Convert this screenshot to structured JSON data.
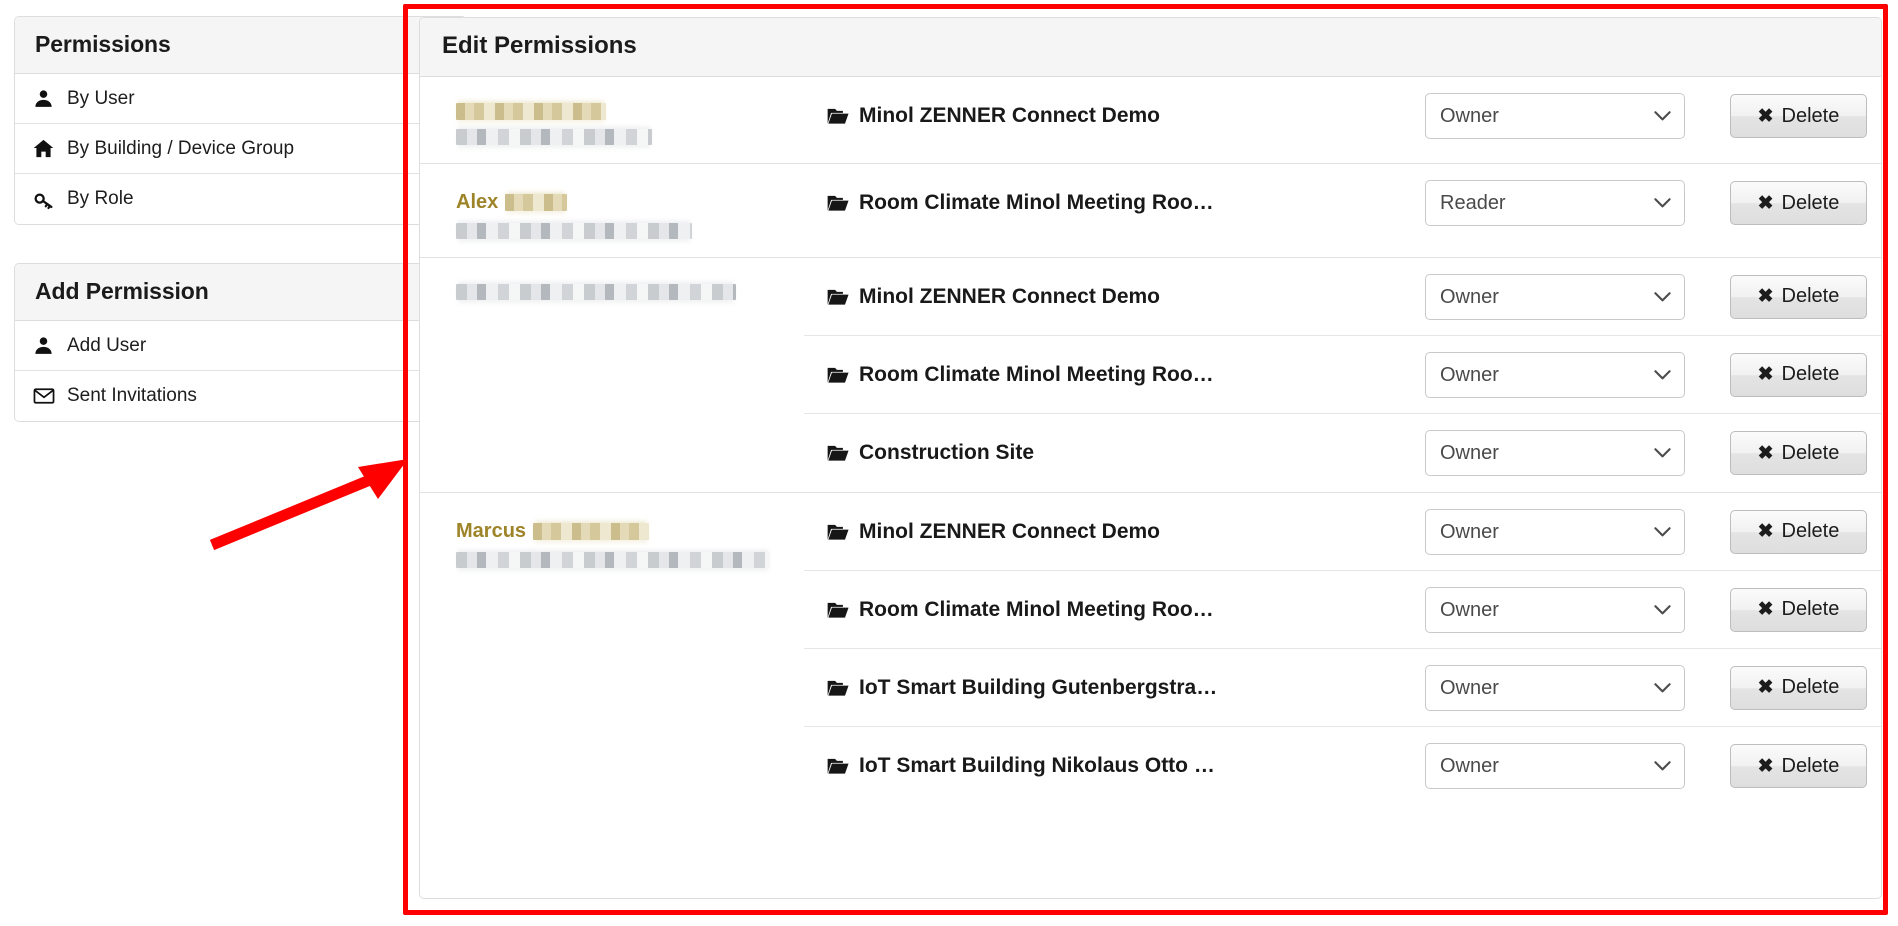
{
  "sidebar": {
    "permissions_panel": {
      "title": "Permissions",
      "items": [
        {
          "label": "By User",
          "icon": "user-icon",
          "selected": true,
          "check_icon": "check-square-icon"
        },
        {
          "label": "By Building / Device Group",
          "icon": "home-icon",
          "selected": false
        },
        {
          "label": "By Role",
          "icon": "key-icon",
          "selected": false
        }
      ]
    },
    "add_permission_panel": {
      "title": "Add Permission",
      "items": [
        {
          "label": "Add User",
          "icon": "user-icon"
        },
        {
          "label": "Sent Invitations",
          "icon": "envelope-icon"
        }
      ]
    }
  },
  "main": {
    "title": "Edit Permissions",
    "role_options": [
      "Owner",
      "Reader"
    ],
    "delete_label": "Delete",
    "delete_icon": "x-icon",
    "folder_icon": "folder-open-icon",
    "groups": [
      {
        "user_name_visible": "",
        "user_name_redacted": true,
        "user_email_redacted": true,
        "permissions": [
          {
            "folder": "Minol ZENNER Connect Demo",
            "role": "Owner"
          }
        ]
      },
      {
        "user_name_visible": "Alex",
        "user_name_redacted": true,
        "user_email_redacted": true,
        "permissions": [
          {
            "folder": "Room Climate Minol Meeting Roo…",
            "role": "Reader"
          }
        ]
      },
      {
        "user_name_visible": "",
        "user_name_redacted": true,
        "user_email_redacted": false,
        "permissions": [
          {
            "folder": "Minol ZENNER Connect Demo",
            "role": "Owner"
          },
          {
            "folder": "Room Climate Minol Meeting Roo…",
            "role": "Owner"
          },
          {
            "folder": "Construction Site",
            "role": "Owner"
          }
        ]
      },
      {
        "user_name_visible": "Marcus",
        "user_name_redacted": true,
        "user_email_redacted": true,
        "permissions": [
          {
            "folder": "Minol ZENNER Connect Demo",
            "role": "Owner"
          },
          {
            "folder": "Room Climate Minol Meeting Roo…",
            "role": "Owner"
          },
          {
            "folder": "IoT Smart Building Gutenbergstra…",
            "role": "Owner"
          },
          {
            "folder": "IoT Smart Building Nikolaus Otto …",
            "role": "Owner"
          }
        ]
      }
    ]
  },
  "annotation": {
    "highlight_color": "#fe0000",
    "arrow_icon": "red-arrow-icon",
    "box_icon": "red-highlight-box"
  }
}
